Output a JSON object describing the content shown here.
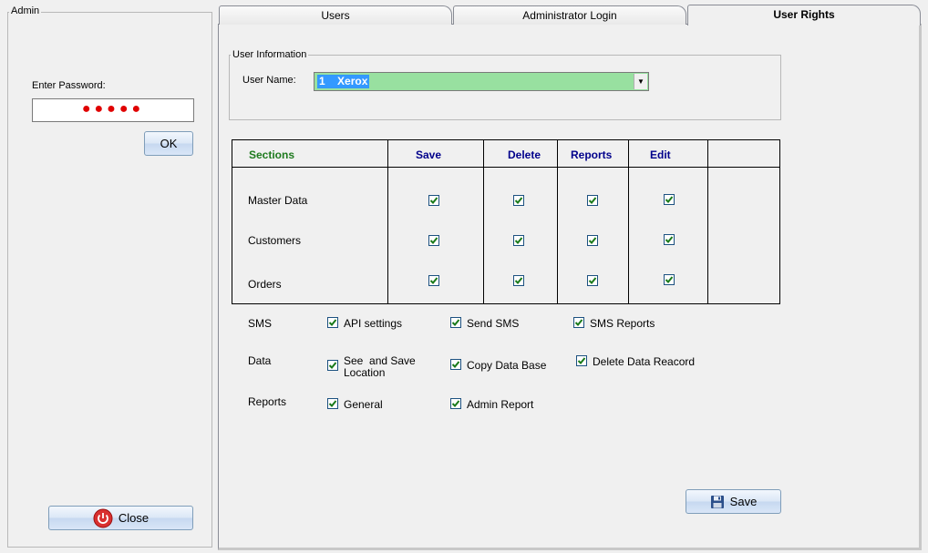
{
  "admin": {
    "legend": "Admin",
    "password_label": "Enter Password:",
    "password_mask": "●●●●●",
    "ok_label": "OK",
    "close_label": "Close"
  },
  "tabs": [
    {
      "label": "Users",
      "active": false
    },
    {
      "label": "Administrator Login",
      "active": false
    },
    {
      "label": "User Rights",
      "active": true
    }
  ],
  "user_info": {
    "legend": "User Information",
    "user_name_label": "User Name:",
    "user_name_value": "1    Xerox"
  },
  "grid": {
    "headers": {
      "sections": "Sections",
      "save": "Save",
      "delete": "Delete",
      "reports": "Reports",
      "edit": "Edit"
    },
    "rows": [
      {
        "label": "Master Data",
        "save": true,
        "delete": true,
        "reports": true,
        "edit": true
      },
      {
        "label": "Customers",
        "save": true,
        "delete": true,
        "reports": true,
        "edit": true
      },
      {
        "label": "Orders",
        "save": true,
        "delete": true,
        "reports": true,
        "edit": true
      }
    ]
  },
  "options": {
    "sms": {
      "label": "SMS",
      "items": [
        "API settings",
        "Send SMS",
        "SMS Reports"
      ]
    },
    "data": {
      "label": "Data",
      "items": [
        "See  and Save Location",
        "Copy Data Base",
        "Delete Data Reacord"
      ]
    },
    "reports": {
      "label": "Reports",
      "items": [
        "General",
        "Admin Report"
      ]
    }
  },
  "save_button_label": "Save",
  "colors": {
    "accent_green": "#98e0a0",
    "header_blue": "#00008b",
    "sections_green": "#1e7a1e",
    "password_dots": "#e00000"
  }
}
